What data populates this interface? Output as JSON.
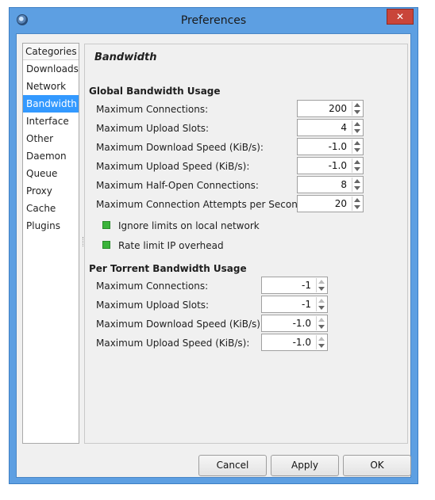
{
  "window": {
    "title": "Preferences",
    "close_glyph": "✕",
    "app_icon": "app-logo-icon"
  },
  "categories": {
    "header": "Categories",
    "items": [
      "Downloads",
      "Network",
      "Bandwidth",
      "Interface",
      "Other",
      "Daemon",
      "Queue",
      "Proxy",
      "Cache",
      "Plugins"
    ],
    "selected": "Bandwidth"
  },
  "panel": {
    "title": "Bandwidth",
    "global": {
      "header": "Global Bandwidth Usage",
      "rows": [
        {
          "label": "Maximum Connections:",
          "value": "200"
        },
        {
          "label": "Maximum Upload Slots:",
          "value": "4"
        },
        {
          "label": "Maximum Download Speed (KiB/s):",
          "value": "-1.0"
        },
        {
          "label": "Maximum Upload Speed (KiB/s):",
          "value": "-1.0"
        },
        {
          "label": "Maximum Half-Open Connections:",
          "value": "8"
        },
        {
          "label": "Maximum Connection Attempts per Second:",
          "value": "20"
        }
      ],
      "checks": [
        {
          "label": "Ignore limits on local network",
          "checked": true
        },
        {
          "label": "Rate limit IP overhead",
          "checked": true
        }
      ]
    },
    "per_torrent": {
      "header": "Per Torrent Bandwidth Usage",
      "rows": [
        {
          "label": "Maximum Connections:",
          "value": "-1"
        },
        {
          "label": "Maximum Upload Slots:",
          "value": "-1"
        },
        {
          "label": "Maximum Download Speed (KiB/s):",
          "value": "-1.0"
        },
        {
          "label": "Maximum Upload Speed (KiB/s):",
          "value": "-1.0"
        }
      ]
    }
  },
  "buttons": {
    "cancel": "Cancel",
    "apply": "Apply",
    "ok": "OK"
  },
  "colors": {
    "accent": "#3399ff",
    "checkbox": "#3bb33b",
    "frame": "#5d9fe2",
    "close": "#c9453a"
  }
}
